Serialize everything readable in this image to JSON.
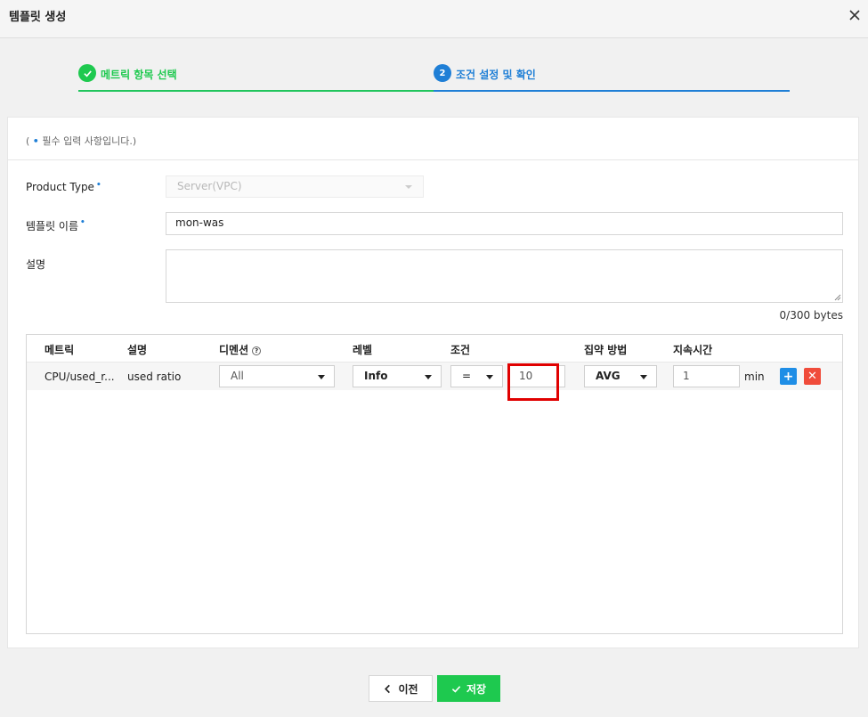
{
  "dialog": {
    "title": "템플릿 생성"
  },
  "stepper": [
    {
      "label": "메트릭 항목 선택",
      "state": "done"
    },
    {
      "number": "2",
      "label": "조건 설정 및 확인",
      "state": "active"
    }
  ],
  "form": {
    "required_note_open": "(",
    "required_note_dot": "•",
    "required_note_text": "필수 입력 사항입니다.)",
    "product_type_label": "Product Type",
    "product_type_value": "Server(VPC)",
    "template_name_label": "템플릿 이름",
    "template_name_value": "mon-was",
    "description_label": "설명",
    "description_value": "",
    "description_counter": "0/300 bytes",
    "required_dot": "•"
  },
  "grid": {
    "headers": {
      "metric": "메트릭",
      "description": "설명",
      "dimension": "디멘션",
      "dimension_help": "?",
      "level": "레벨",
      "condition": "조건",
      "aggregation": "집약 방법",
      "duration": "지속시간"
    },
    "rows": [
      {
        "metric": "CPU/used_r...",
        "description": "used ratio",
        "dimension": "All",
        "level": "Info",
        "operator": "=",
        "threshold": "10",
        "aggregation": "AVG",
        "duration": "1",
        "duration_unit": "min",
        "add_label": "+",
        "delete_label": "✕"
      }
    ]
  },
  "footer": {
    "prev_label": "이전",
    "save_label": "저장"
  },
  "colors": {
    "step_done": "#1ec94f",
    "step_active": "#1f7fd6",
    "highlight": "#e00000",
    "add_button": "#1f8ee6",
    "delete_button": "#f04c3b",
    "save_button": "#1ec94f"
  }
}
